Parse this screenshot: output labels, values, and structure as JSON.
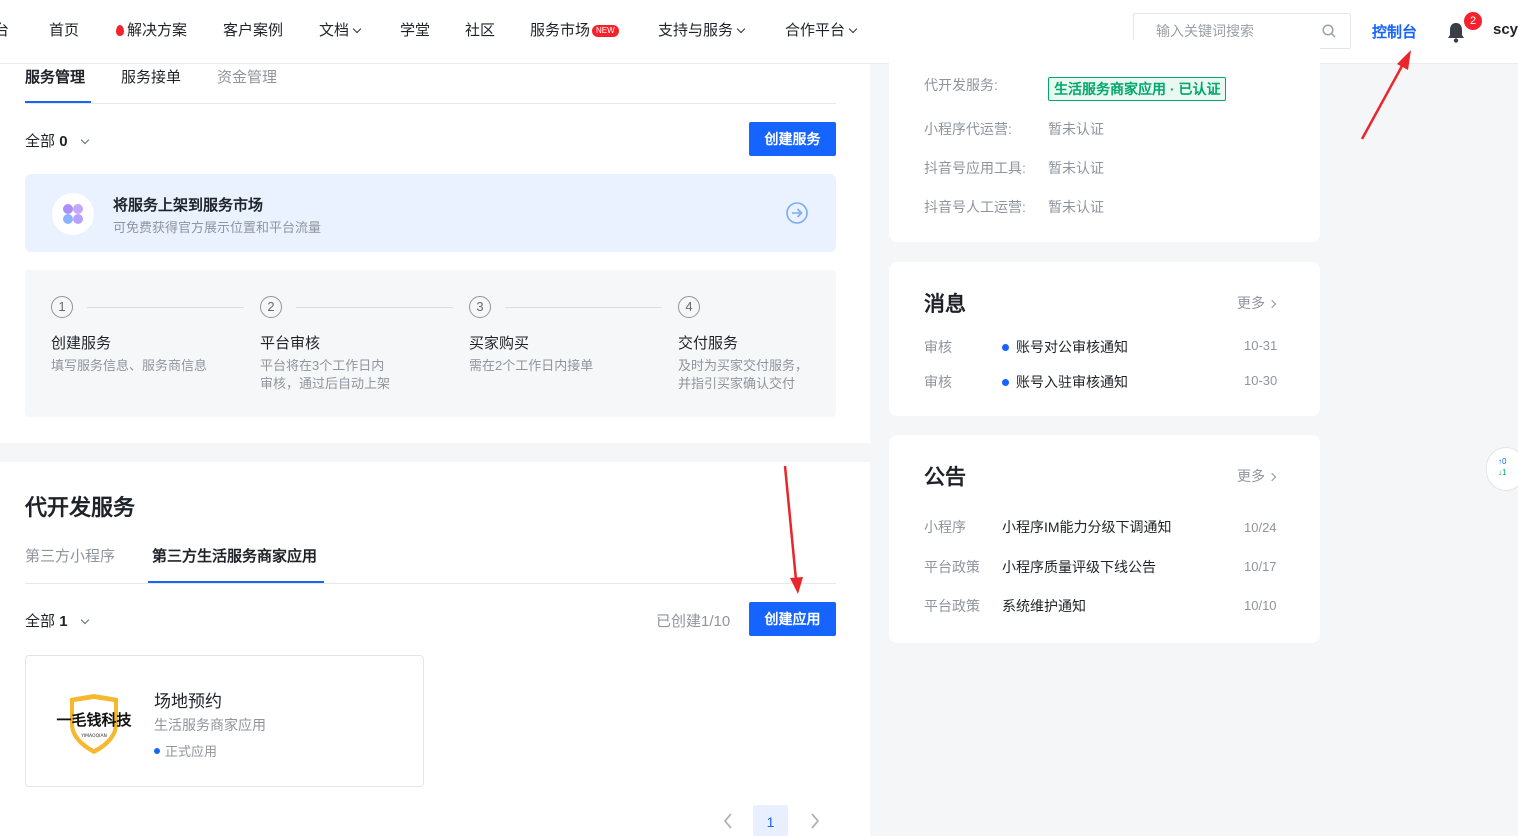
{
  "header": {
    "cut_logo_text": "台",
    "nav": [
      {
        "label": "首页"
      },
      {
        "label": "解决方案"
      },
      {
        "label": "客户案例"
      },
      {
        "label": "文档"
      },
      {
        "label": "学堂"
      },
      {
        "label": "社区"
      },
      {
        "label": "服务市场",
        "badge": "NEW"
      },
      {
        "label": "支持与服务"
      },
      {
        "label": "合作平台"
      }
    ],
    "search_placeholder": "输入关键词搜索",
    "console_label": "控制台",
    "notification_count": "2",
    "user_name": "scy"
  },
  "service_mgmt": {
    "tabs": [
      {
        "label": "服务管理"
      },
      {
        "label": "服务接单"
      },
      {
        "label": "资金管理"
      }
    ],
    "filter_label": "全部",
    "filter_count": "0",
    "create_button": "创建服务",
    "promo": {
      "title": "将服务上架到服务市场",
      "subtitle": "可免费获得官方展示位置和平台流量"
    },
    "steps": [
      {
        "num": "1",
        "title": "创建服务",
        "desc": [
          "填写服务信息、服务商信息"
        ]
      },
      {
        "num": "2",
        "title": "平台审核",
        "desc": [
          "平台将在3个工作日内",
          "审核，通过后自动上架"
        ]
      },
      {
        "num": "3",
        "title": "买家购买",
        "desc": [
          "需在2个工作日内接单"
        ]
      },
      {
        "num": "4",
        "title": "交付服务",
        "desc": [
          "及时为买家交付服务，",
          "并指引买家确认交付"
        ]
      }
    ]
  },
  "dev_service": {
    "title": "代开发服务",
    "tabs": [
      {
        "label": "第三方小程序"
      },
      {
        "label": "第三方生活服务商家应用"
      }
    ],
    "filter_label": "全部",
    "filter_count": "1",
    "created_count": "已创建1/10",
    "create_button": "创建应用",
    "app": {
      "logo_text": "一毛钱科技",
      "logo_subtext": "YIMAOQIAN",
      "name": "场地预约",
      "type": "生活服务商家应用",
      "status": "正式应用"
    },
    "pager_current": "1"
  },
  "certification": {
    "rows": [
      {
        "label": "代开发服务:",
        "value": "生活服务商家应用 · 已认证"
      },
      {
        "label": "小程序代运营:",
        "value": "暂未认证"
      },
      {
        "label": "抖音号应用工具:",
        "value": "暂未认证"
      },
      {
        "label": "抖音号人工运营:",
        "value": "暂未认证"
      }
    ]
  },
  "messages": {
    "title": "消息",
    "more": "更多",
    "items": [
      {
        "category": "审核",
        "title": "账号对公审核通知",
        "date": "10-31"
      },
      {
        "category": "审核",
        "title": "账号入驻审核通知",
        "date": "10-30"
      }
    ]
  },
  "announcements": {
    "title": "公告",
    "more": "更多",
    "items": [
      {
        "category": "小程序",
        "title": "小程序IM能力分级下调通知",
        "date": "10/24"
      },
      {
        "category": "平台政策",
        "title": "小程序质量评级下线公告",
        "date": "10/17"
      },
      {
        "category": "平台政策",
        "title": "系统维护通知",
        "date": "10/10"
      }
    ]
  },
  "float_widget": {
    "up": "0",
    "down": "1"
  },
  "colors": {
    "accent": "#1664ff",
    "success": "#00a86b",
    "danger": "#f5222d",
    "annotation": "#e8262b"
  }
}
